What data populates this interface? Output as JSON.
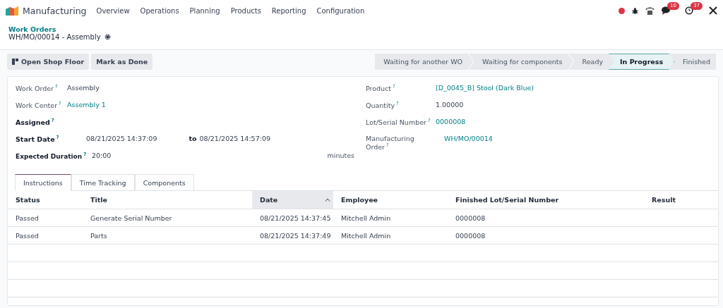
{
  "navbar": {
    "app_name": "Manufacturing",
    "menu": [
      "Overview",
      "Operations",
      "Planning",
      "Products",
      "Reporting",
      "Configuration"
    ],
    "badges": {
      "messages": "10",
      "activities": "37"
    }
  },
  "breadcrumb": {
    "parent": "Work Orders",
    "current": "WH/MO/00014 - Assembly"
  },
  "buttons": [
    "Open Shop Floor",
    "Mark as Done"
  ],
  "stages": [
    {
      "label": "Waiting for another WO",
      "selected": false
    },
    {
      "label": "Waiting for components",
      "selected": false
    },
    {
      "label": "Ready",
      "selected": false
    },
    {
      "label": "In Progress",
      "selected": true
    },
    {
      "label": "Finished",
      "selected": false
    }
  ],
  "left_fields": [
    {
      "kind": "text",
      "label": "Work Order",
      "help": "?",
      "required": false,
      "value": "Assembly"
    },
    {
      "kind": "link",
      "label": "Work Center",
      "help": "?",
      "required": false,
      "value": "Assembly 1"
    },
    {
      "kind": "empty",
      "label": "Assigned",
      "help": "?",
      "required": true
    },
    {
      "kind": "daterange",
      "label": "Start Date",
      "help": "?",
      "required": true,
      "value": "08/21/2025 14:37:09",
      "joiner": "to",
      "end": "08/21/2025 14:57:09"
    },
    {
      "kind": "duration",
      "label": "Expected Duration",
      "help": "?",
      "required": true,
      "value": "20:00",
      "unit": "minutes"
    }
  ],
  "right_fields": [
    {
      "kind": "link",
      "label": "Product",
      "help": "?",
      "value": "[D_0045_B] Stool (Dark Blue)"
    },
    {
      "kind": "text",
      "label": "Quantity",
      "help": "?",
      "value": "1.00000"
    },
    {
      "kind": "link",
      "label": "Lot/Serial Number",
      "help": "?",
      "value": "0000008"
    },
    {
      "kind": "link",
      "label": "Manufacturing Order",
      "help": "?",
      "value": "WH/MO/00014"
    }
  ],
  "tabs": [
    {
      "label": "Instructions",
      "selected": true
    },
    {
      "label": "Time Tracking",
      "selected": false
    },
    {
      "label": "Components",
      "selected": false
    }
  ],
  "table": {
    "columns": [
      {
        "label": "Status",
        "sorted": false
      },
      {
        "label": "Title",
        "sorted": false
      },
      {
        "label": "Date",
        "sorted": true
      },
      {
        "label": "Employee",
        "sorted": false
      },
      {
        "label": "Finished Lot/Serial Number",
        "sorted": false
      },
      {
        "label": "Result",
        "sorted": false
      }
    ],
    "rows": [
      [
        "Passed",
        "Generate Serial Number",
        "08/21/2025 14:37:45",
        "Mitchell Admin",
        "0000008",
        ""
      ],
      [
        "Passed",
        "Parts",
        "08/21/2025 14:37:49",
        "Mitchell Admin",
        "0000008",
        ""
      ]
    ]
  }
}
